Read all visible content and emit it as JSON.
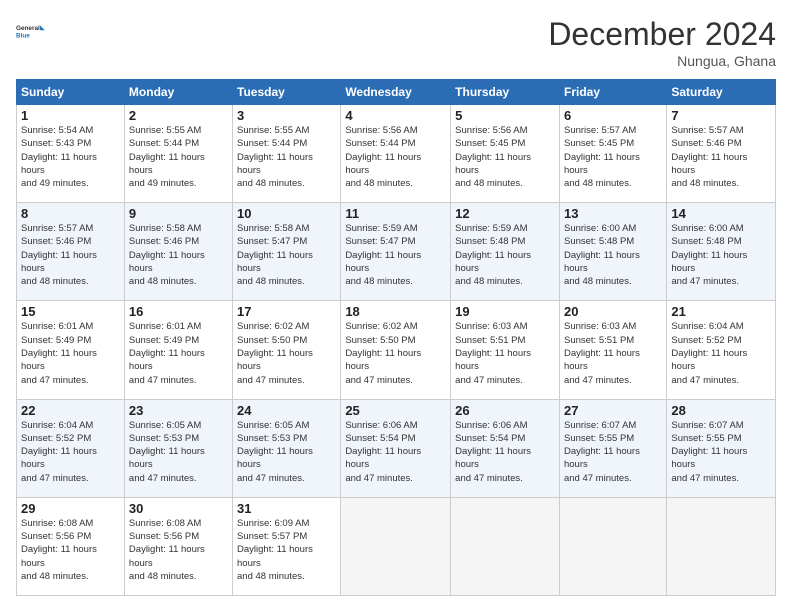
{
  "logo": {
    "line1": "General",
    "line2": "Blue"
  },
  "title": "December 2024",
  "location": "Nungua, Ghana",
  "days_of_week": [
    "Sunday",
    "Monday",
    "Tuesday",
    "Wednesday",
    "Thursday",
    "Friday",
    "Saturday"
  ],
  "weeks": [
    [
      {
        "day": 1,
        "sunrise": "5:54 AM",
        "sunset": "5:43 PM",
        "daylight": "11 hours and 49 minutes"
      },
      {
        "day": 2,
        "sunrise": "5:55 AM",
        "sunset": "5:44 PM",
        "daylight": "11 hours and 49 minutes"
      },
      {
        "day": 3,
        "sunrise": "5:55 AM",
        "sunset": "5:44 PM",
        "daylight": "11 hours and 48 minutes"
      },
      {
        "day": 4,
        "sunrise": "5:56 AM",
        "sunset": "5:44 PM",
        "daylight": "11 hours and 48 minutes"
      },
      {
        "day": 5,
        "sunrise": "5:56 AM",
        "sunset": "5:45 PM",
        "daylight": "11 hours and 48 minutes"
      },
      {
        "day": 6,
        "sunrise": "5:57 AM",
        "sunset": "5:45 PM",
        "daylight": "11 hours and 48 minutes"
      },
      {
        "day": 7,
        "sunrise": "5:57 AM",
        "sunset": "5:46 PM",
        "daylight": "11 hours and 48 minutes"
      }
    ],
    [
      {
        "day": 8,
        "sunrise": "5:57 AM",
        "sunset": "5:46 PM",
        "daylight": "11 hours and 48 minutes"
      },
      {
        "day": 9,
        "sunrise": "5:58 AM",
        "sunset": "5:46 PM",
        "daylight": "11 hours and 48 minutes"
      },
      {
        "day": 10,
        "sunrise": "5:58 AM",
        "sunset": "5:47 PM",
        "daylight": "11 hours and 48 minutes"
      },
      {
        "day": 11,
        "sunrise": "5:59 AM",
        "sunset": "5:47 PM",
        "daylight": "11 hours and 48 minutes"
      },
      {
        "day": 12,
        "sunrise": "5:59 AM",
        "sunset": "5:48 PM",
        "daylight": "11 hours and 48 minutes"
      },
      {
        "day": 13,
        "sunrise": "6:00 AM",
        "sunset": "5:48 PM",
        "daylight": "11 hours and 48 minutes"
      },
      {
        "day": 14,
        "sunrise": "6:00 AM",
        "sunset": "5:48 PM",
        "daylight": "11 hours and 47 minutes"
      }
    ],
    [
      {
        "day": 15,
        "sunrise": "6:01 AM",
        "sunset": "5:49 PM",
        "daylight": "11 hours and 47 minutes"
      },
      {
        "day": 16,
        "sunrise": "6:01 AM",
        "sunset": "5:49 PM",
        "daylight": "11 hours and 47 minutes"
      },
      {
        "day": 17,
        "sunrise": "6:02 AM",
        "sunset": "5:50 PM",
        "daylight": "11 hours and 47 minutes"
      },
      {
        "day": 18,
        "sunrise": "6:02 AM",
        "sunset": "5:50 PM",
        "daylight": "11 hours and 47 minutes"
      },
      {
        "day": 19,
        "sunrise": "6:03 AM",
        "sunset": "5:51 PM",
        "daylight": "11 hours and 47 minutes"
      },
      {
        "day": 20,
        "sunrise": "6:03 AM",
        "sunset": "5:51 PM",
        "daylight": "11 hours and 47 minutes"
      },
      {
        "day": 21,
        "sunrise": "6:04 AM",
        "sunset": "5:52 PM",
        "daylight": "11 hours and 47 minutes"
      }
    ],
    [
      {
        "day": 22,
        "sunrise": "6:04 AM",
        "sunset": "5:52 PM",
        "daylight": "11 hours and 47 minutes"
      },
      {
        "day": 23,
        "sunrise": "6:05 AM",
        "sunset": "5:53 PM",
        "daylight": "11 hours and 47 minutes"
      },
      {
        "day": 24,
        "sunrise": "6:05 AM",
        "sunset": "5:53 PM",
        "daylight": "11 hours and 47 minutes"
      },
      {
        "day": 25,
        "sunrise": "6:06 AM",
        "sunset": "5:54 PM",
        "daylight": "11 hours and 47 minutes"
      },
      {
        "day": 26,
        "sunrise": "6:06 AM",
        "sunset": "5:54 PM",
        "daylight": "11 hours and 47 minutes"
      },
      {
        "day": 27,
        "sunrise": "6:07 AM",
        "sunset": "5:55 PM",
        "daylight": "11 hours and 47 minutes"
      },
      {
        "day": 28,
        "sunrise": "6:07 AM",
        "sunset": "5:55 PM",
        "daylight": "11 hours and 47 minutes"
      }
    ],
    [
      {
        "day": 29,
        "sunrise": "6:08 AM",
        "sunset": "5:56 PM",
        "daylight": "11 hours and 48 minutes"
      },
      {
        "day": 30,
        "sunrise": "6:08 AM",
        "sunset": "5:56 PM",
        "daylight": "11 hours and 48 minutes"
      },
      {
        "day": 31,
        "sunrise": "6:09 AM",
        "sunset": "5:57 PM",
        "daylight": "11 hours and 48 minutes"
      },
      null,
      null,
      null,
      null
    ]
  ]
}
